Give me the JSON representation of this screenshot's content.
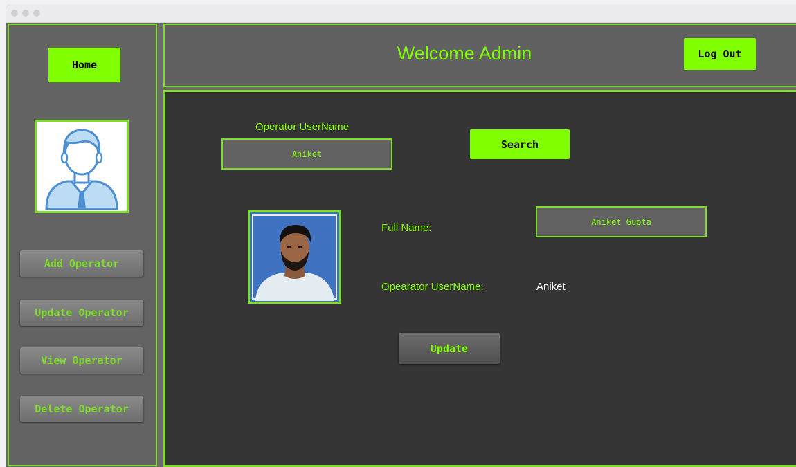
{
  "header": {
    "title": "Welcome Admin",
    "logout_label": "Log Out"
  },
  "sidebar": {
    "home_label": "Home",
    "items": [
      {
        "label": "Add Operator"
      },
      {
        "label": "Update Operator"
      },
      {
        "label": "View Operator"
      },
      {
        "label": "Delete Operator"
      }
    ]
  },
  "search": {
    "label": "Operator UserName",
    "value": "Aniket",
    "button_label": "Search"
  },
  "details": {
    "full_name_label": "Full Name:",
    "full_name_value": "Aniket Gupta",
    "username_label": "Opearator UserName:",
    "username_value": "Aniket"
  },
  "update_label": "Update",
  "colors": {
    "accent": "#80ff00",
    "border": "#7edc2a",
    "panel": "#353535",
    "sidebar": "#636363"
  },
  "icons": [
    "admin-avatar-icon",
    "operator-photo"
  ]
}
